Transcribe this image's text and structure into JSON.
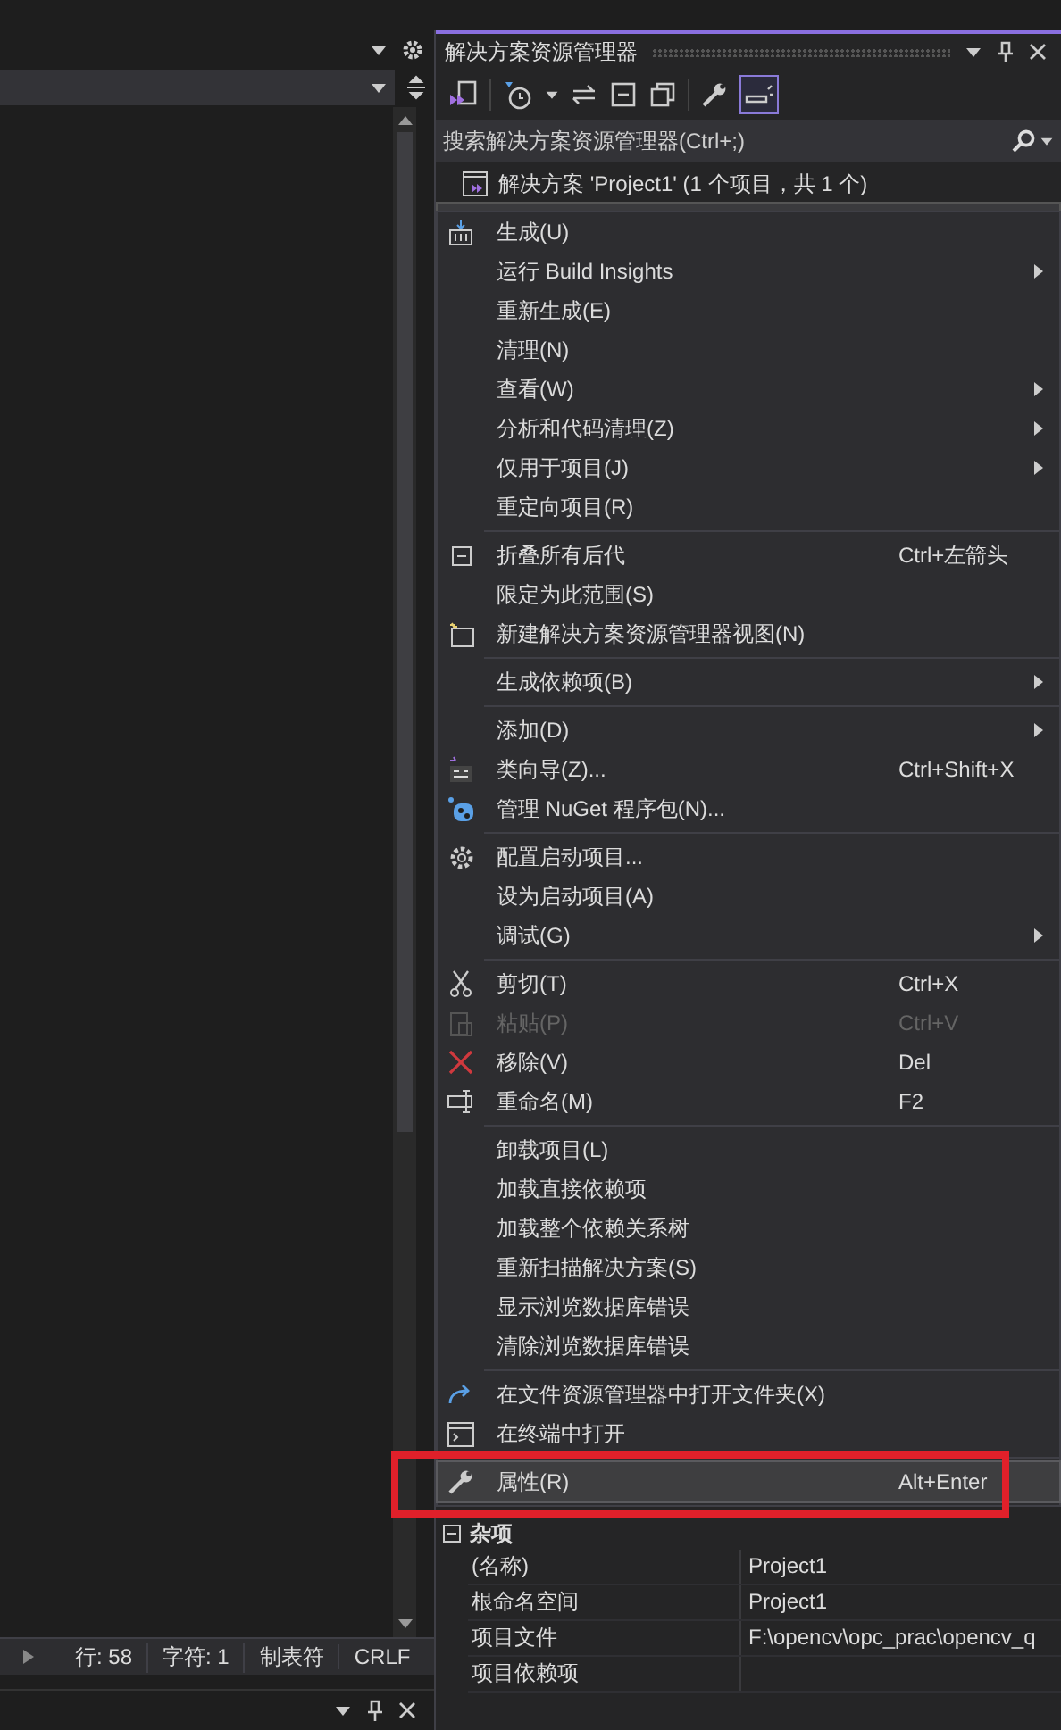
{
  "editor": {
    "status_bar": [
      "行: 58",
      "字符: 1",
      "制表符",
      "CRLF"
    ]
  },
  "solution_explorer": {
    "title": "解决方案资源管理器",
    "search": {
      "placeholder": "搜索解决方案资源管理器(Ctrl+;)"
    },
    "tree": [
      {
        "label": "解决方案 'Project1' (1 个项目，共 1 个)"
      }
    ]
  },
  "context_menu": [
    {
      "kind": "item",
      "label": "生成(U)",
      "submenu": false,
      "disabled": false,
      "selected": false,
      "annotated": false
    },
    {
      "kind": "item",
      "label": "运行 Build Insights",
      "submenu": true,
      "disabled": false,
      "selected": false,
      "annotated": false
    },
    {
      "kind": "item",
      "label": "重新生成(E)",
      "submenu": false,
      "disabled": false,
      "selected": false,
      "annotated": false
    },
    {
      "kind": "item",
      "label": "清理(N)",
      "submenu": false,
      "disabled": false,
      "selected": false,
      "annotated": false
    },
    {
      "kind": "item",
      "label": "查看(W)",
      "submenu": true,
      "disabled": false,
      "selected": false,
      "annotated": false
    },
    {
      "kind": "item",
      "label": "分析和代码清理(Z)",
      "submenu": true,
      "disabled": false,
      "selected": false,
      "annotated": false
    },
    {
      "kind": "item",
      "label": "仅用于项目(J)",
      "submenu": true,
      "disabled": false,
      "selected": false,
      "annotated": false
    },
    {
      "kind": "item",
      "label": "重定向项目(R)",
      "submenu": false,
      "disabled": false,
      "selected": false,
      "annotated": false
    },
    {
      "kind": "separator"
    },
    {
      "kind": "item",
      "label": "折叠所有后代",
      "shortcut": "Ctrl+左箭头",
      "submenu": false,
      "disabled": false,
      "selected": false,
      "annotated": false
    },
    {
      "kind": "item",
      "label": "限定为此范围(S)",
      "submenu": false,
      "disabled": false,
      "selected": false,
      "annotated": false
    },
    {
      "kind": "item",
      "label": "新建解决方案资源管理器视图(N)",
      "submenu": false,
      "disabled": false,
      "selected": false,
      "annotated": false
    },
    {
      "kind": "separator"
    },
    {
      "kind": "item",
      "label": "生成依赖项(B)",
      "submenu": true,
      "disabled": false,
      "selected": false,
      "annotated": false
    },
    {
      "kind": "separator"
    },
    {
      "kind": "item",
      "label": "添加(D)",
      "submenu": true,
      "disabled": false,
      "selected": false,
      "annotated": false
    },
    {
      "kind": "item",
      "label": "类向导(Z)...",
      "shortcut": "Ctrl+Shift+X",
      "submenu": false,
      "disabled": false,
      "selected": false,
      "annotated": false
    },
    {
      "kind": "item",
      "label": "管理 NuGet 程序包(N)...",
      "submenu": false,
      "disabled": false,
      "selected": false,
      "annotated": false
    },
    {
      "kind": "separator"
    },
    {
      "kind": "item",
      "label": "配置启动项目...",
      "submenu": false,
      "disabled": false,
      "selected": false,
      "annotated": false
    },
    {
      "kind": "item",
      "label": "设为启动项目(A)",
      "submenu": false,
      "disabled": false,
      "selected": false,
      "annotated": false
    },
    {
      "kind": "item",
      "label": "调试(G)",
      "submenu": true,
      "disabled": false,
      "selected": false,
      "annotated": false
    },
    {
      "kind": "separator"
    },
    {
      "kind": "item",
      "label": "剪切(T)",
      "shortcut": "Ctrl+X",
      "submenu": false,
      "disabled": false,
      "selected": false,
      "annotated": false
    },
    {
      "kind": "item",
      "label": "粘贴(P)",
      "shortcut": "Ctrl+V",
      "submenu": false,
      "disabled": true,
      "selected": false,
      "annotated": false
    },
    {
      "kind": "item",
      "label": "移除(V)",
      "shortcut": "Del",
      "submenu": false,
      "disabled": false,
      "selected": false,
      "annotated": false
    },
    {
      "kind": "item",
      "label": "重命名(M)",
      "shortcut": "F2",
      "submenu": false,
      "disabled": false,
      "selected": false,
      "annotated": false
    },
    {
      "kind": "separator"
    },
    {
      "kind": "item",
      "label": "卸载项目(L)",
      "submenu": false,
      "disabled": false,
      "selected": false,
      "annotated": false
    },
    {
      "kind": "item",
      "label": "加载直接依赖项",
      "submenu": false,
      "disabled": false,
      "selected": false,
      "annotated": false
    },
    {
      "kind": "item",
      "label": "加载整个依赖关系树",
      "submenu": false,
      "disabled": false,
      "selected": false,
      "annotated": false
    },
    {
      "kind": "item",
      "label": "重新扫描解决方案(S)",
      "submenu": false,
      "disabled": false,
      "selected": false,
      "annotated": false
    },
    {
      "kind": "item",
      "label": "显示浏览数据库错误",
      "submenu": false,
      "disabled": false,
      "selected": false,
      "annotated": false
    },
    {
      "kind": "item",
      "label": "清除浏览数据库错误",
      "submenu": false,
      "disabled": false,
      "selected": false,
      "annotated": false
    },
    {
      "kind": "separator"
    },
    {
      "kind": "item",
      "label": "在文件资源管理器中打开文件夹(X)",
      "submenu": false,
      "disabled": false,
      "selected": false,
      "annotated": false
    },
    {
      "kind": "item",
      "label": "在终端中打开",
      "submenu": false,
      "disabled": false,
      "selected": false,
      "annotated": false
    },
    {
      "kind": "separator"
    },
    {
      "kind": "item",
      "label": "属性(R)",
      "shortcut": "Alt+Enter",
      "submenu": false,
      "disabled": false,
      "selected": true,
      "annotated": true
    }
  ],
  "properties": {
    "group": "杂项",
    "rows": [
      {
        "name": "(名称)",
        "value": "Project1"
      },
      {
        "name": "根命名空间",
        "value": "Project1"
      },
      {
        "name": "项目文件",
        "value": "F:\\opencv\\opc_prac\\opencv_q"
      },
      {
        "name": "项目依赖项"
      }
    ]
  }
}
